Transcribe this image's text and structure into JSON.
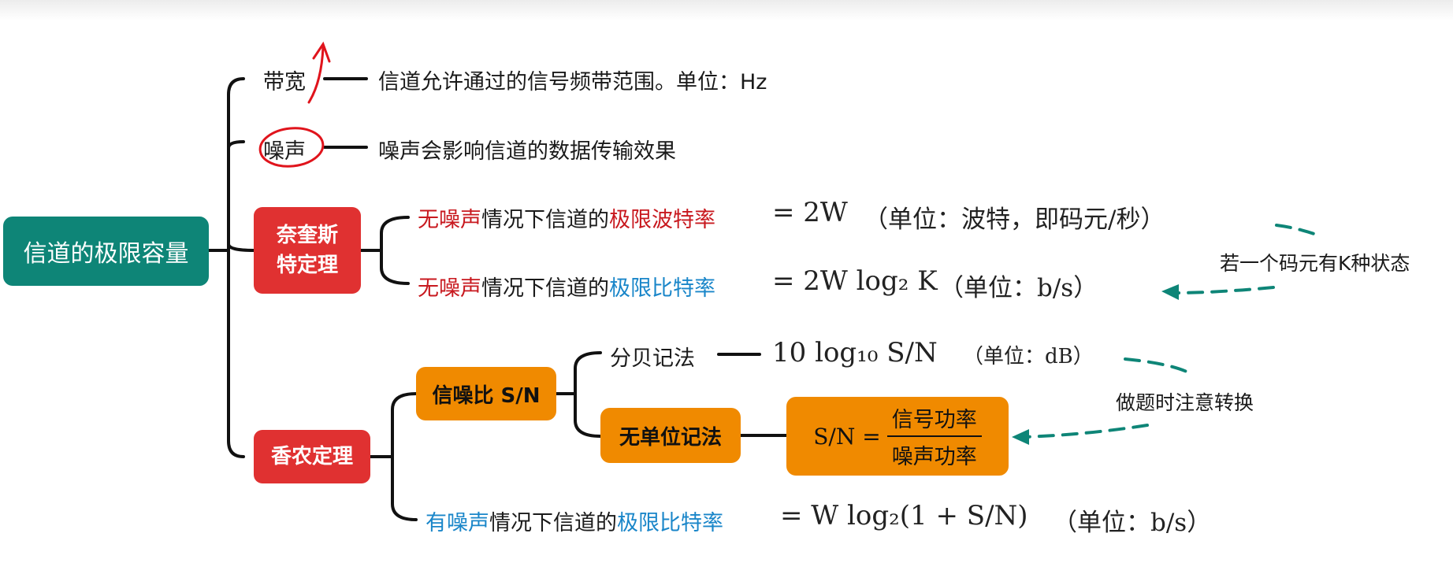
{
  "root": "信道的极限容量",
  "bandwidth": {
    "term": "带宽",
    "desc": "信道允许通过的信号频带范围。单位：Hz"
  },
  "noise": {
    "term": "噪声",
    "desc": "噪声会影响信道的数据传输效果"
  },
  "nyquist": {
    "title_line1": "奈奎斯",
    "title_line2": "特定理",
    "row1": {
      "prefix": "无噪声",
      "mid": "情况下信道的",
      "term": "极限波特率",
      "formula": "= 2W",
      "unit": "（单位：波特，即码元/秒）"
    },
    "row2": {
      "prefix": "无噪声",
      "mid": "情况下信道的",
      "term": "极限比特率",
      "formula": "= 2W log₂ K",
      "unit": "（单位：b/s）"
    },
    "note": "若一个码元有K种状态"
  },
  "shannon": {
    "title": "香农定理",
    "snr": {
      "title": "信噪比 S/N",
      "db": {
        "label": "分贝记法",
        "formula": "10 log₁₀ S/N",
        "unit": "（单位：dB）"
      },
      "unitless": {
        "label": "无单位记法",
        "lhs": "S/N =",
        "numerator": "信号功率",
        "denominator": "噪声功率"
      },
      "note": "做题时注意转换"
    },
    "row": {
      "prefix": "有噪声",
      "mid": "情况下信道的",
      "term": "极限比特率",
      "formula": "= W log₂(1 + S/N)",
      "unit": "（单位：b/s）"
    }
  },
  "colors": {
    "root": "#0e8577",
    "theorem": "#e03131",
    "snr": "#f08a00",
    "term_red": "#c8191f",
    "term_blue": "#1a86c9",
    "arrow": "#0e8577",
    "annotation": "#e0141c"
  }
}
